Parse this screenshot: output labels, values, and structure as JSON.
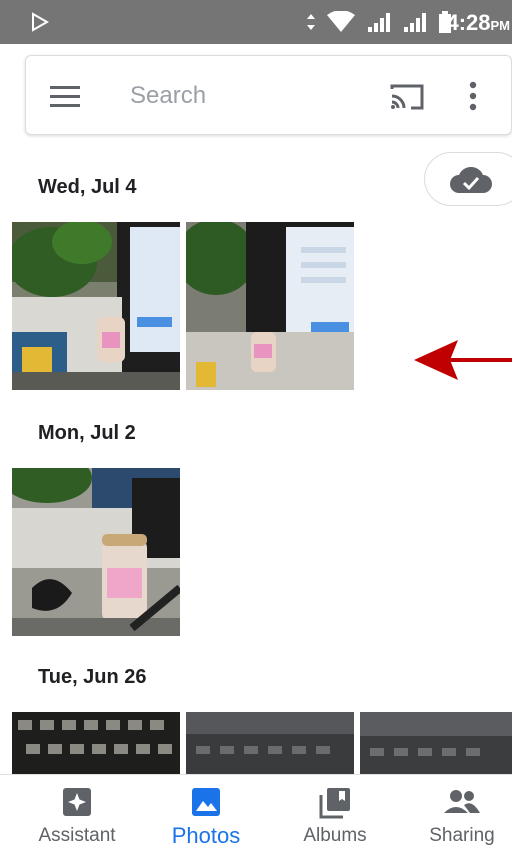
{
  "status_bar": {
    "time": "4:28",
    "ampm": "PM"
  },
  "search": {
    "placeholder": "Search"
  },
  "sections": [
    {
      "date": "Wed, Jul 4"
    },
    {
      "date": "Mon, Jul 2"
    },
    {
      "date": "Tue, Jun 26"
    }
  ],
  "bottom_nav": [
    {
      "label": "Assistant",
      "icon": "assistant-icon"
    },
    {
      "label": "Photos",
      "icon": "photos-icon",
      "active": true
    },
    {
      "label": "Albums",
      "icon": "albums-icon"
    },
    {
      "label": "Sharing",
      "icon": "sharing-icon"
    }
  ],
  "colors": {
    "status_bar": "#757575",
    "accent": "#1a73e8",
    "annotation_arrow": "#c00000"
  }
}
